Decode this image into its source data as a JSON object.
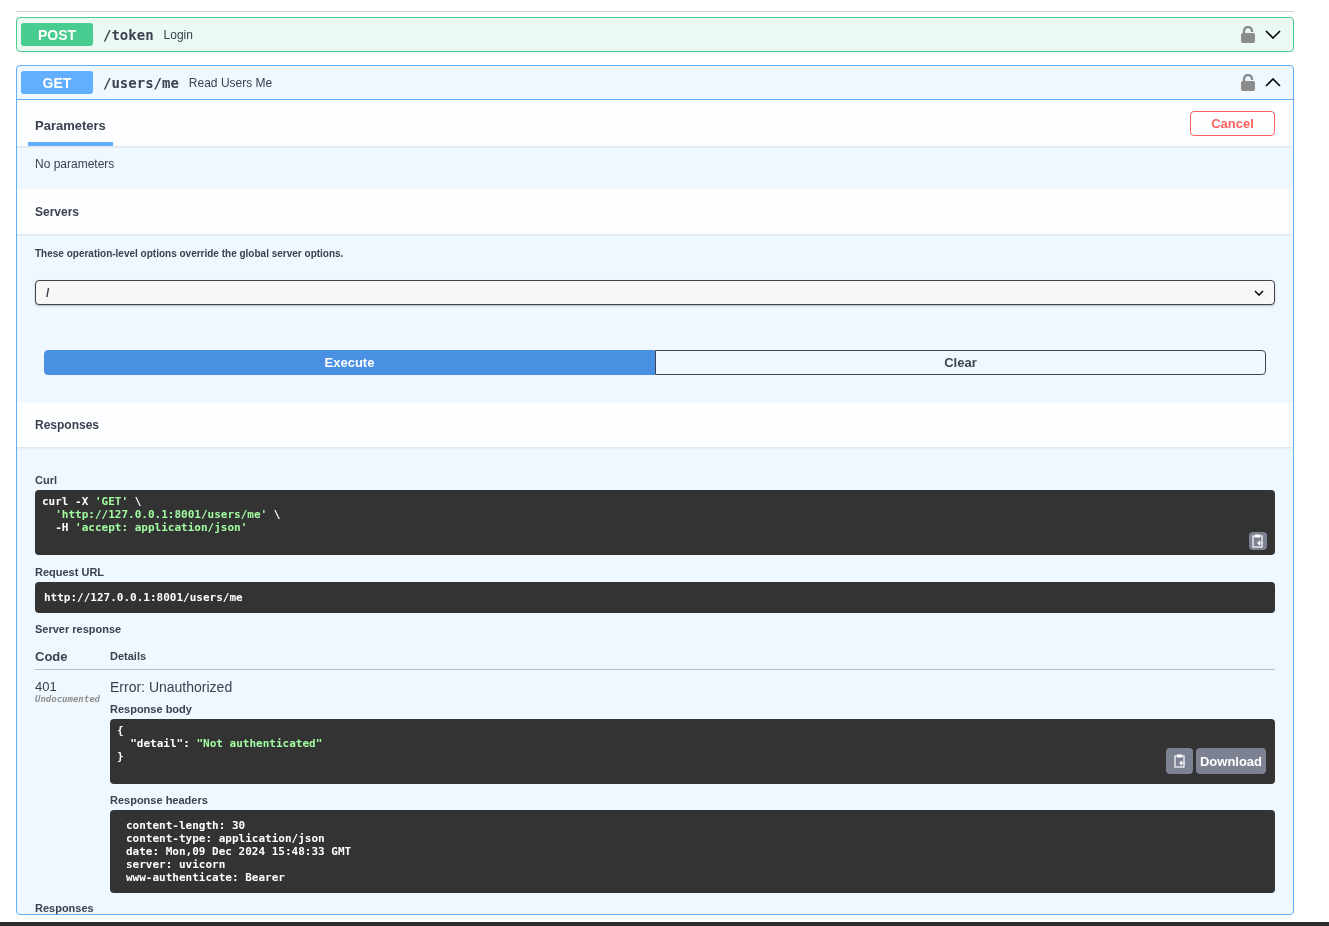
{
  "operations": [
    {
      "method": "POST",
      "path": "/token",
      "summary": "Login",
      "expanded": false
    },
    {
      "method": "GET",
      "path": "/users/me",
      "summary": "Read Users Me",
      "expanded": true
    }
  ],
  "parameters": {
    "tab": {
      "label": "Parameters",
      "selected": true
    },
    "cancel_button": "Cancel",
    "empty_message": "No parameters"
  },
  "servers": {
    "title": "Servers",
    "note": "These operation-level options override the global server options.",
    "selected_server": "/"
  },
  "actions": {
    "execute": "Execute",
    "clear": "Clear"
  },
  "responses": {
    "title": "Responses",
    "curl": {
      "label": "Curl",
      "lines": [
        {
          "indented": false,
          "parts": [
            {
              "kind": "plain",
              "text": "curl -X "
            },
            {
              "kind": "string",
              "text": "'GET'"
            },
            {
              "kind": "plain",
              "text": " \\"
            }
          ]
        },
        {
          "indented": true,
          "parts": [
            {
              "kind": "string",
              "text": "'http://127.0.0.1:8001/users/me'"
            },
            {
              "kind": "plain",
              "text": " \\"
            }
          ]
        },
        {
          "indented": true,
          "parts": [
            {
              "kind": "plain",
              "text": "-H "
            },
            {
              "kind": "string",
              "text": "'accept: application/json'"
            }
          ]
        }
      ]
    },
    "request_url": {
      "label": "Request URL",
      "value": "http://127.0.0.1:8001/users/me"
    },
    "server_response": {
      "label": "Server response",
      "columns": [
        "Code",
        "Details"
      ],
      "code": "401",
      "code_note": "Undocumented",
      "details_title": "Error: Unauthorized",
      "body_label": "Response body",
      "body_lines": [
        {
          "indented": false,
          "parts": [
            {
              "kind": "plain",
              "text": "{"
            }
          ]
        },
        {
          "indented": true,
          "parts": [
            {
              "kind": "plain",
              "text": "\"detail\": "
            },
            {
              "kind": "string",
              "text": "\"Not authenticated\""
            }
          ]
        },
        {
          "indented": false,
          "parts": [
            {
              "kind": "plain",
              "text": "}"
            }
          ]
        }
      ],
      "download_button": "Download",
      "headers_label": "Response headers",
      "headers_lines": [
        "content-length: 30",
        "content-type: application/json",
        "date: Mon,09 Dec 2024 15:48:33 GMT",
        "server: uvicorn",
        "www-authenticate: Bearer"
      ]
    },
    "footer_title": "Responses"
  }
}
